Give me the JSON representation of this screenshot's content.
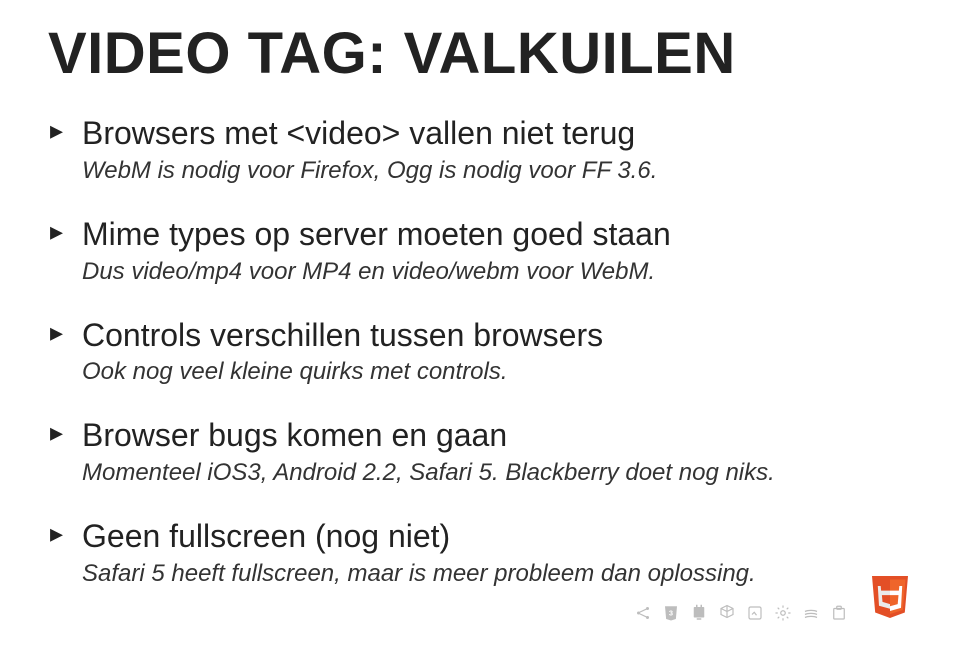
{
  "title": "VIDEO TAG: VALKUILEN",
  "bullets": [
    {
      "main": "Browsers met <video> vallen niet terug",
      "sub": "WebM is nodig voor Firefox, Ogg is nodig voor FF 3.6."
    },
    {
      "main": "Mime types op server moeten goed staan",
      "sub": "Dus video/mp4 voor MP4 en video/webm voor WebM."
    },
    {
      "main": "Controls verschillen tussen browsers",
      "sub": "Ook nog veel kleine quirks met controls."
    },
    {
      "main": "Browser bugs komen en gaan",
      "sub": "Momenteel iOS3, Android 2.2, Safari 5. Blackberry doet nog niks."
    },
    {
      "main": "Geen fullscreen (nog niet)",
      "sub": "Safari 5 heeft fullscreen, maar is meer probleem dan oplossing."
    }
  ],
  "colors": {
    "accent": "#e34f26",
    "icon_grey": "#bdbdbd"
  }
}
